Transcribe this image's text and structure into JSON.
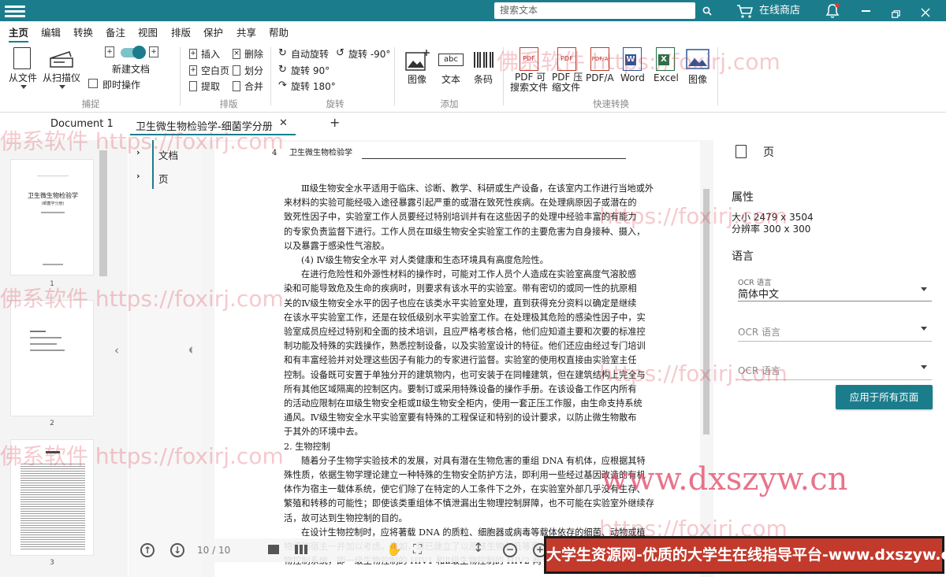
{
  "titlebar": {
    "search_placeholder": "搜索文本",
    "store_label": "在线商店"
  },
  "ribbon": {
    "tabs": [
      "主页",
      "编辑",
      "转换",
      "备注",
      "视图",
      "排版",
      "保护",
      "共享",
      "帮助"
    ],
    "capture": {
      "from_file": "从文件",
      "from_scanner": "从扫描仪",
      "new_doc": "新建文档",
      "instant": "即时操作",
      "group": "捕捉"
    },
    "layout": {
      "insert": "插入",
      "delete": "删除",
      "blank_page": "空白页",
      "split": "划分",
      "extract": "提取",
      "merge": "合并",
      "group": "排版"
    },
    "rotate": {
      "auto": "自动旋转",
      "ccw90": "旋转 -90°",
      "cw90": "旋转 90°",
      "r180": "旋转 180°",
      "group": "旋转"
    },
    "add": {
      "image": "图像",
      "text": "文本",
      "barcode": "条码",
      "group": "添加"
    },
    "convert": {
      "pdf_searchable_1": "PDF 可",
      "pdf_searchable_2": "搜索文件",
      "pdf_compress_1": "PDF 压",
      "pdf_compress_2": "缩文件",
      "pdfa": "PDF/A",
      "word": "Word",
      "excel": "Excel",
      "image": "图像",
      "group": "快速转换",
      "icon_pdf": "PDF",
      "icon_pdfa": "PDF/A"
    }
  },
  "doc_tabs": {
    "doc1": "Document 1",
    "doc2": "卫生微生物检验学-细菌学分册",
    "close": "✕",
    "add": "+"
  },
  "thumbs": {
    "page_numbers": [
      "1",
      "2",
      "3"
    ],
    "thumb1_title": "卫生微生物检验学",
    "thumb1_sub": "(细菌学分册)"
  },
  "outline": {
    "items": [
      "文档",
      "页"
    ]
  },
  "page": {
    "header_num": "4",
    "header_title": "卫生微生物检验学",
    "lines": [
      "Ⅲ级生物安全水平适用于临床、诊断、教学、科研或生产设备，在该室内工作进行当地或外",
      "来材料的实验可能经吸入途径暴露引起严重的或潜在致死性疾病。在处理病原因子或潜在的",
      "致死性因子中，实验室工作人员要经过特别培训并有在这些因子的处理中经验丰富的有能力",
      "的专家负责监督下进行。工作人员在Ⅲ级生物安全实验室工作的主要危害为自身接种、摄入，",
      "以及暴露于感染性气溶胶。",
      "(4) Ⅳ级生物安全水平   对人类健康和生态环境具有高度危险性。",
      "在进行危险性和外源性材料的操作时，可能对工作人员个人造成在实验室高度气溶胶感",
      "染和可能导致危及生命的疾病时，则要求有该水平的实验室。带有密切的或同一性的抗原相",
      "关的Ⅳ级生物安全水平的因子也应在该类水平实验室处理，直到获得充分资料以确定是继续",
      "在该水平实验室工作，还是在较低级别水平实验室工作。在处理极其危险的感染性因子中，实",
      "验室成员应经过特别和全面的技术培训，且应严格考核合格，他们应知道主要和次要的标准控",
      "制功能及特殊的实践操作，熟悉控制设备，以及实验室设计的特征。他们还应由经过专门培训",
      "和有丰富经验并对处理这些因子有能力的专家进行监督。实验室的使用权直接由实验室主任",
      "控制。设备既可安置于单独分开的建筑物内，也可安装于在同幢建筑，但在建筑结构上完全与",
      "所有其他区域隔离的控制区内。要制订或采用特殊设备的操作手册。在该设备工作区内所有",
      "的活动应限制在Ⅲ级生物安全柜或Ⅱ级生物安全柜内，使用一套正压工作服，由生命支持系统",
      "通风。Ⅳ级生物安全水平实验室要有特殊的工程保证和特别的设计要求，以防止微生物散布",
      "于其外的环境中去。",
      "2. 生物控制",
      "随着分子生物学实验技术的发展，对具有潜在生物危害的重组 DNA 有机体，应根据其特",
      "殊性质，依据生物学理论建立一种特殊的生物安全防护方法，即利用一些经过基因改造的有机",
      "体作为宿主一载体系统，使它们除了在特定的人工条件下之外，在实验室外部几乎没有生存、",
      "繁殖和转移的可能性；即使该类重组体不慎泄漏出生物理控制屏障，也不可能在实验室外继续存",
      "活，故可达到生物控制的目的。",
      "在设计生物控制时，应将著载 DNA 的质粒、细胞器或病毒等载体依存的细菌、动物或植",
      "物细胞宿主一并加以考虑。例如，现已建立了以原核生物和低等真核细胞生物作为宿主的生",
      "物控制系统，即一级生物控制的 HIV1 和Ⅱ级生物控制的 HIV2 两个类别"
    ]
  },
  "viewer_nav": {
    "page_indicator": "10 / 10"
  },
  "props": {
    "header": "页",
    "attributes_title": "属性",
    "size": "大小 2479 x 3504",
    "resolution": "分辨率 300 x 300",
    "language_title": "语言",
    "ocr_label": "OCR 语言",
    "ocr_value": "简体中文",
    "ocr_placeholder_2": "OCR 语言",
    "ocr_placeholder_3": "OCR 语言",
    "apply_all": "应用于所有页面"
  },
  "watermarks": {
    "foxirj": "佛系软件 https://foxirj.com",
    "foxirj_short": "https://foxirj.com",
    "dxszyw": "www.dxszyw.cn"
  },
  "banner": {
    "text": "大学生资源网-优质的大学生在线指导平台-www.dxszyw.cn"
  },
  "colors": {
    "accent": "#1b7d8c",
    "banner_bg": "#c23a2c"
  },
  "icons": [
    "hamburger-icon",
    "search-icon",
    "cart-icon",
    "bell-icon",
    "minimize-icon",
    "restore-icon",
    "close-icon"
  ]
}
